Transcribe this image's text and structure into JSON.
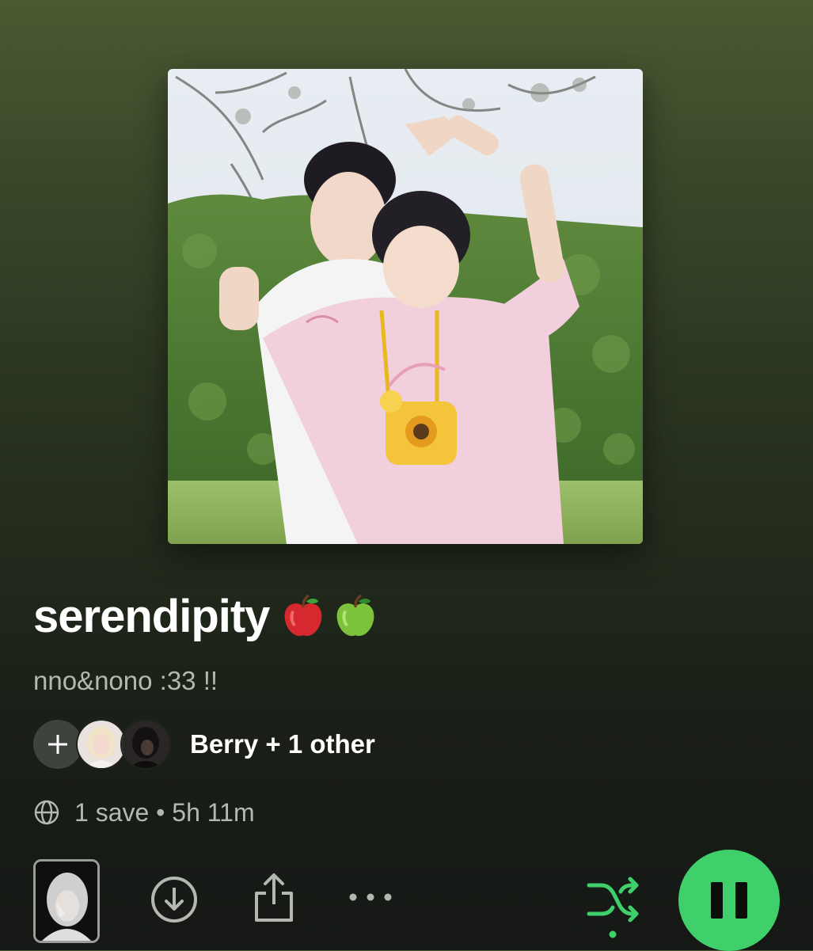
{
  "playlist": {
    "title": "serendipity",
    "title_emojis": [
      "red-apple",
      "green-apple"
    ],
    "description": "nno&nono :33 !!",
    "collaborators_label": "Berry + 1 other",
    "meta": "1 save • 5h 11m"
  },
  "actions": {
    "add_collaborator_icon": "plus-icon",
    "download_icon": "download-icon",
    "share_icon": "share-icon",
    "more_icon": "more-options-icon",
    "shuffle_icon": "shuffle-icon",
    "shuffle_active": true,
    "playback_state": "playing",
    "play_pause_icon": "pause-icon"
  },
  "colors": {
    "accent_green": "#3fd06b",
    "background_top": "#4a5a32",
    "background_bottom": "#151815",
    "secondary_text": "#b5b8b1"
  }
}
